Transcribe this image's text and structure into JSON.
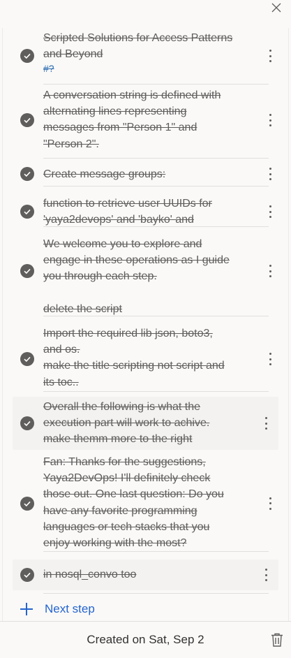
{
  "header": {
    "close_icon": "close-icon"
  },
  "steps": [
    {
      "text": "Scripted Solutions for Access Patterns\nand Beyond",
      "tag": "#?"
    },
    {
      "text": "A conversation string is defined with\nalternating lines representing\nmessages from \"Person 1\" and\n\"Person 2\"."
    },
    {
      "text": "Create message groups:"
    },
    {
      "text": "function to retrieve user UUIDs for\n'yaya2devops' and 'bayko' and"
    },
    {
      "text": "We welcome you to explore and\nengage in these operations as I guide\nyou through each step."
    },
    {
      "text": "Import the required lib json, boto3,\nand os.\nmake the title scripting not script and\nits toc.."
    },
    {
      "text": "Overall the following is what the\nexecution part will work to achive.\n make themm more to the right"
    },
    {
      "text": "Fan: Thanks for the suggestions,\nYaya2DevOps! I'll definitely check\nthose out. One last question: Do you\nhave any favorite programming\nlanguages or tech stacks that you\nenjoy working with the most?"
    },
    {
      "text": "in nosql_convo too"
    }
  ],
  "extra_line": "delete the script",
  "next_step_label": "Next step",
  "footer": {
    "created_label": "Created on Sat, Sep 2",
    "trash_icon": "trash-icon"
  },
  "colors": {
    "accent": "#2564cf",
    "check_bg": "#605e5c",
    "text": "#605e5c"
  }
}
